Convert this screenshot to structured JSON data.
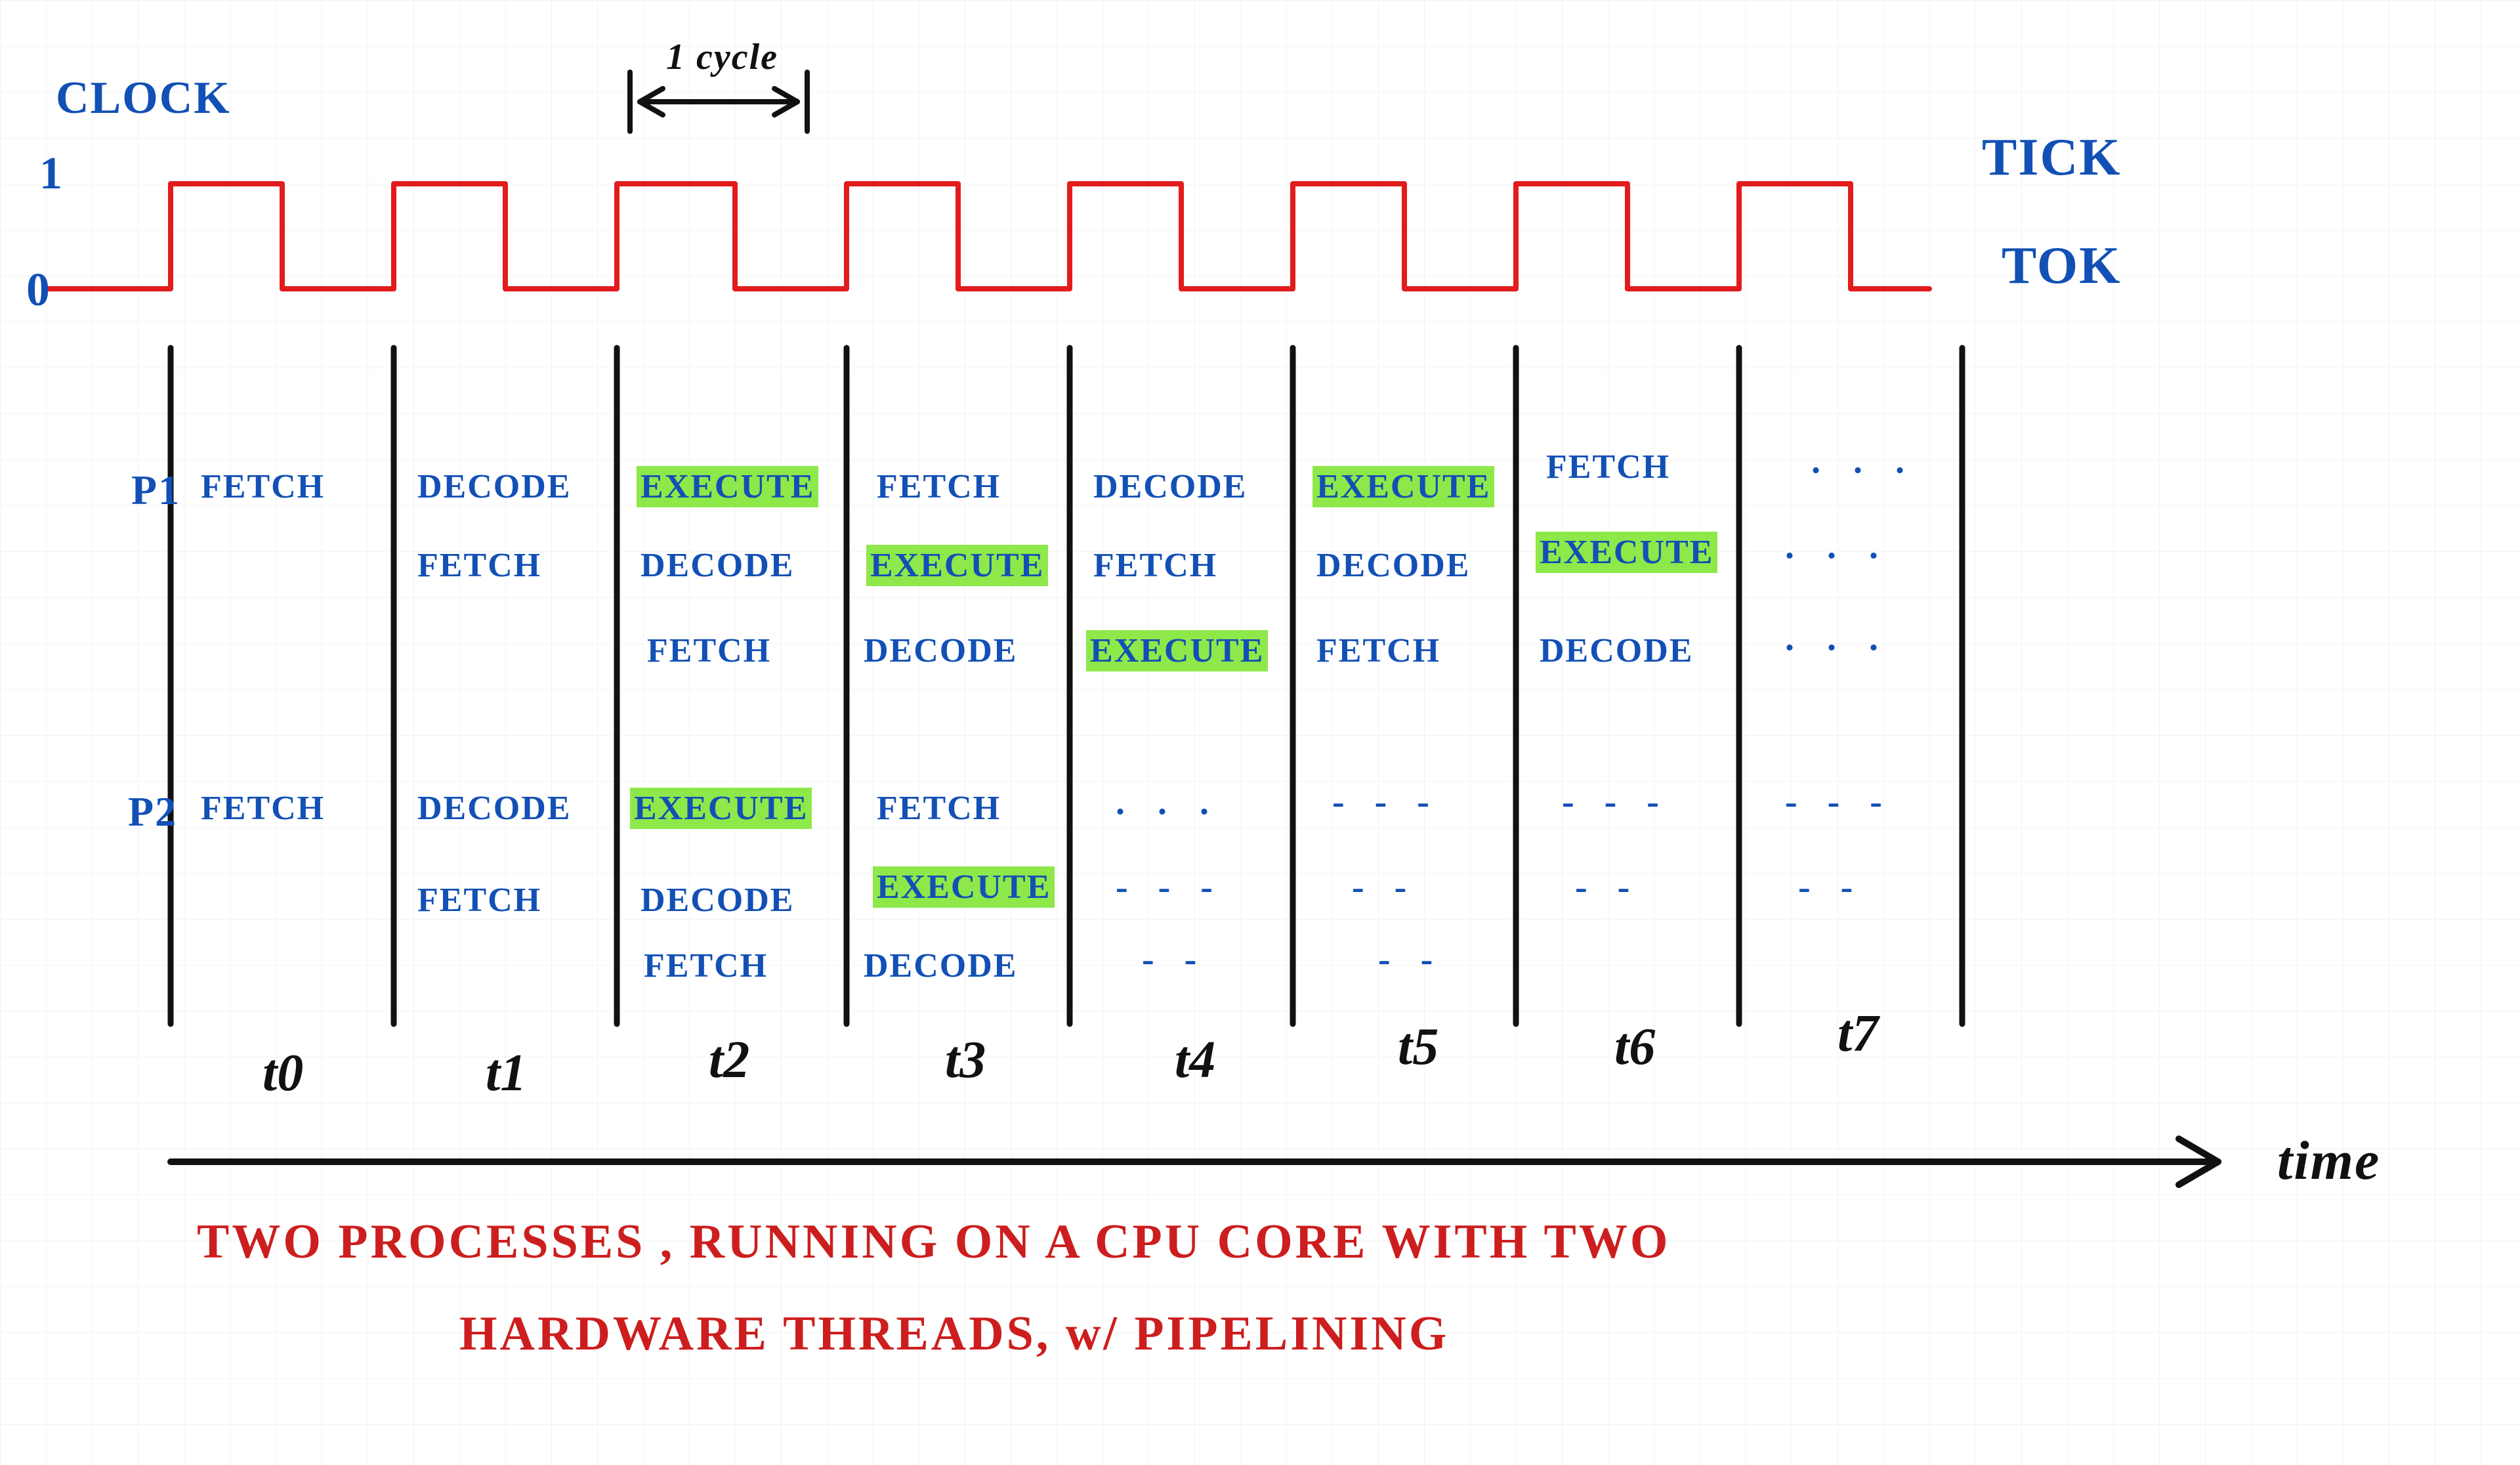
{
  "labels": {
    "clock": "CLOCK",
    "one_cycle": "1 cycle",
    "tick": "TICK",
    "tok": "TOK",
    "axis_one": "1",
    "axis_zero": "0",
    "p1": "P1",
    "p2": "P2",
    "time": "time",
    "caption_line1": "TWO PROCESSES ,  RUNNING ON A CPU CORE  WITH  TWO",
    "caption_line2": "HARDWARE  THREADS,  w/  PIPELINING"
  },
  "time_ticks": [
    "t0",
    "t1",
    "t2",
    "t3",
    "t4",
    "t5",
    "t6",
    "t7"
  ],
  "stages": {
    "fetch": "FETCH",
    "decode": "DECODE",
    "execute": "EXECUTE"
  },
  "chart_data": {
    "type": "table",
    "title": "Two processes running on a CPU core with two hardware threads, with pipelining",
    "columns": [
      "t0",
      "t1",
      "t2",
      "t3",
      "t4",
      "t5",
      "t6",
      "t7"
    ],
    "clock_waveform_cycles": 8,
    "processes": [
      {
        "name": "P1",
        "pipelines": [
          {
            "start": 0,
            "stages": [
              "FETCH",
              "DECODE",
              "EXECUTE",
              "FETCH",
              "DECODE",
              "EXECUTE",
              "FETCH",
              "..."
            ]
          },
          {
            "start": 1,
            "stages": [
              "FETCH",
              "DECODE",
              "EXECUTE",
              "FETCH",
              "DECODE",
              "EXECUTE",
              "..."
            ]
          },
          {
            "start": 2,
            "stages": [
              "FETCH",
              "DECODE",
              "EXECUTE",
              "FETCH",
              "DECODE",
              "..."
            ]
          }
        ]
      },
      {
        "name": "P2",
        "pipelines": [
          {
            "start": 0,
            "stages": [
              "FETCH",
              "DECODE",
              "EXECUTE",
              "FETCH",
              "...",
              "...",
              "...",
              "..."
            ]
          },
          {
            "start": 1,
            "stages": [
              "FETCH",
              "DECODE",
              "EXECUTE",
              "...",
              "...",
              "...",
              "..."
            ]
          },
          {
            "start": 2,
            "stages": [
              "FETCH",
              "DECODE",
              "...",
              "...",
              "..."
            ]
          }
        ]
      }
    ],
    "highlighted_stage": "EXECUTE"
  }
}
